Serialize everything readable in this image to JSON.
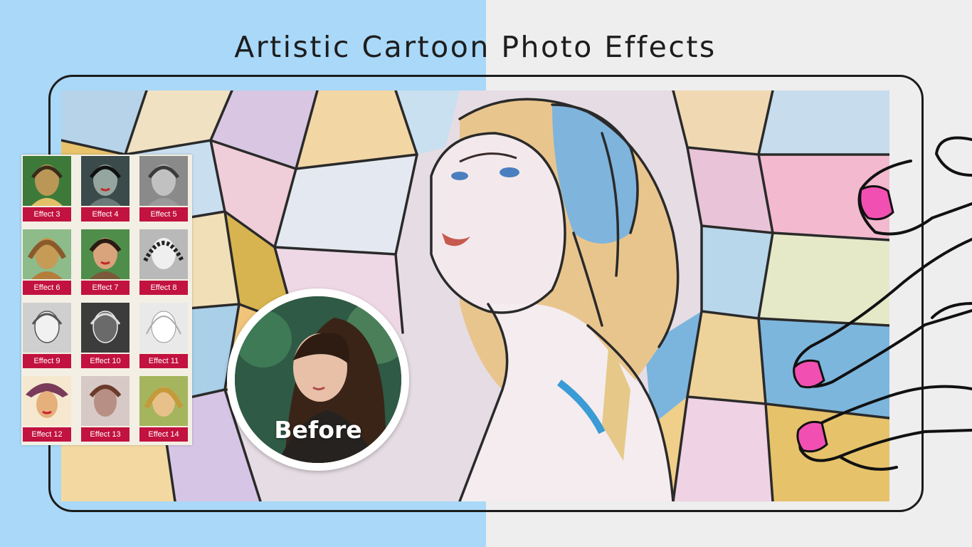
{
  "headline": {
    "title": "Artistic Cartoon Photo Effects"
  },
  "preview": {
    "style": "stained glass cartoon portrait"
  },
  "effects": [
    {
      "label": "Effect 3",
      "color": "#3d7a3a"
    },
    {
      "label": "Effect 4",
      "color": "#3b4a4a"
    },
    {
      "label": "Effect 5",
      "color": "#8a8a8a"
    },
    {
      "label": "Effect 6",
      "color": "#c59b55"
    },
    {
      "label": "Effect 7",
      "color": "#7a5a3a"
    },
    {
      "label": "Effect 8",
      "color": "#b9b9b9"
    },
    {
      "label": "Effect 9",
      "color": "#cfcfcf"
    },
    {
      "label": "Effect 10",
      "color": "#3c3c3c"
    },
    {
      "label": "Effect 11",
      "color": "#e9e9e9"
    },
    {
      "label": "Effect 12",
      "color": "#e5b07a"
    },
    {
      "label": "Effect 13",
      "color": "#b88f84"
    },
    {
      "label": "Effect 14",
      "color": "#a5b55d"
    }
  ],
  "before_badge": {
    "label": "Before"
  },
  "colors": {
    "accent": "#c2123f",
    "left_bg": "#a9d8f8",
    "right_bg": "#eeeeee",
    "nail": "#f24fb3"
  }
}
